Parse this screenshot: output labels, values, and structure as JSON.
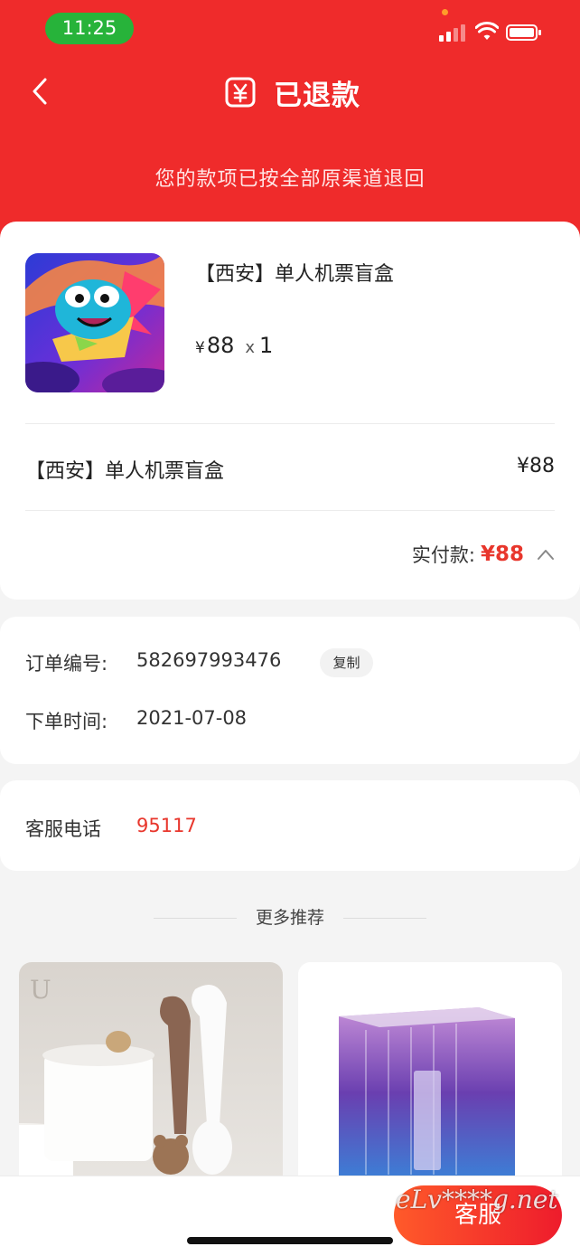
{
  "status_bar": {
    "time": "11:25"
  },
  "header": {
    "title": "已退款",
    "subtitle": "您的款项已按全部原渠道退回",
    "title_icon": "yen-receipt-icon",
    "back_icon": "chevron-left-icon"
  },
  "product": {
    "name": "【西安】单人机票盲盒",
    "currency": "¥",
    "price": "88",
    "qty_symbol": "x",
    "qty": "1",
    "line_name": "【西安】单人机票盲盒",
    "line_price": "¥88",
    "paid_label": "实付款:",
    "paid_value": "¥88"
  },
  "order": {
    "number_label": "订单编号:",
    "number_value": "582697993476",
    "copy_label": "复制",
    "time_label": "下单时间:",
    "time_value": "2021-07-08"
  },
  "service": {
    "phone_label": "客服电话",
    "phone_value": "95117"
  },
  "recommend": {
    "title": "更多推荐"
  },
  "bottom": {
    "service_button": "客服"
  },
  "watermark": "eLv****g.net",
  "colors": {
    "header_red": "#ef2b2b",
    "accent_red": "#e8362c",
    "pill_green": "#27b33a"
  }
}
